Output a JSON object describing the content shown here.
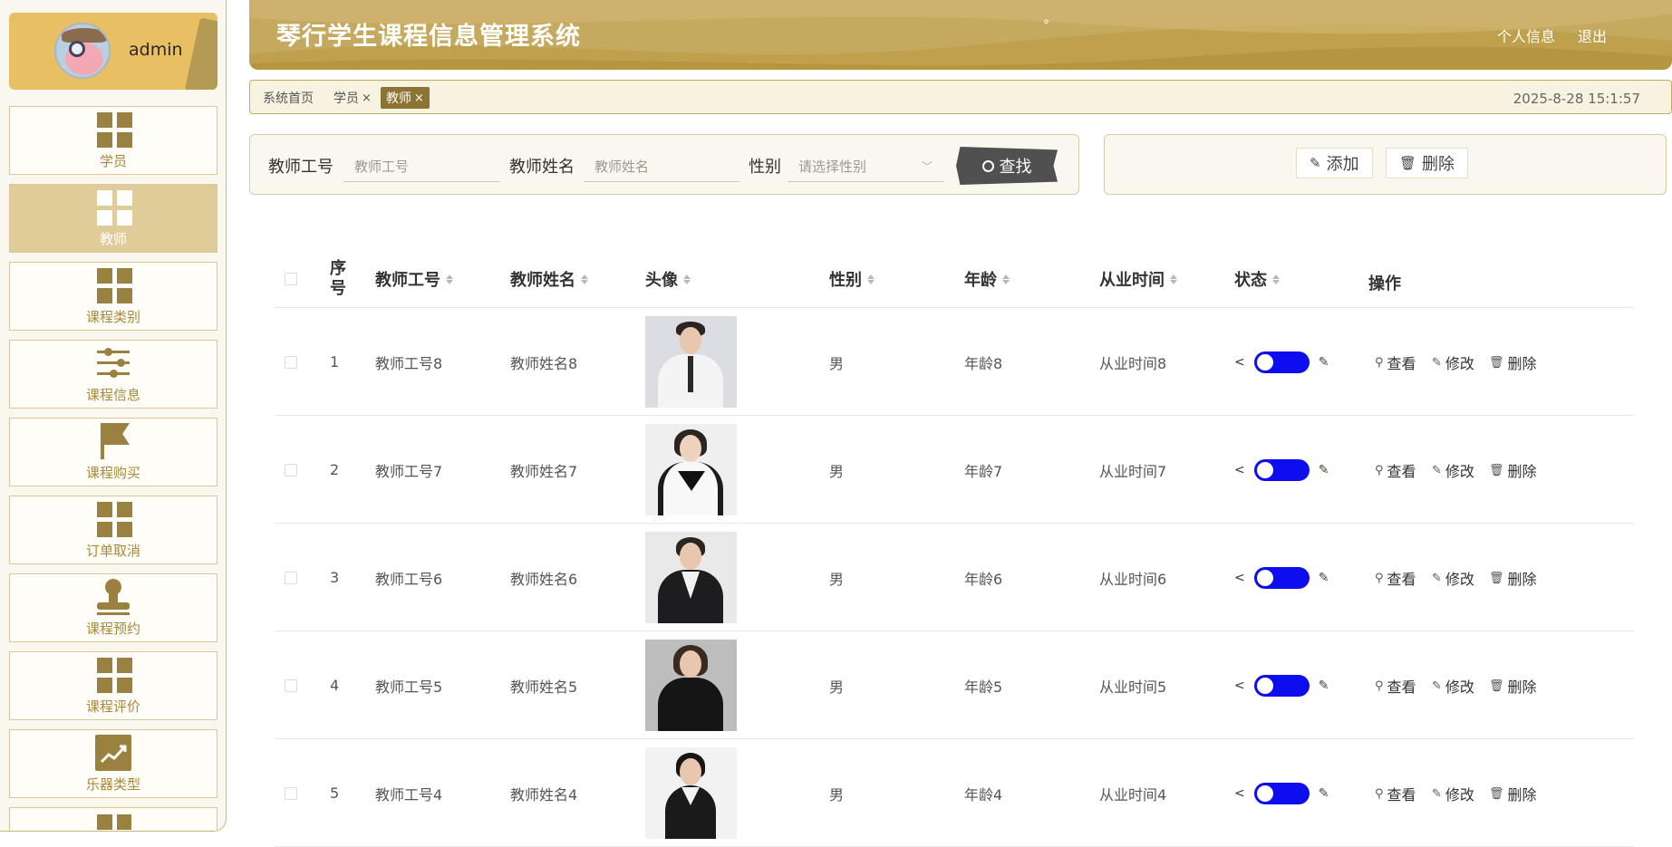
{
  "sidebar": {
    "username": "admin",
    "menu": [
      {
        "label": "学员",
        "icon": "grid-icon"
      },
      {
        "label": "教师",
        "icon": "grid-icon"
      },
      {
        "label": "课程类别",
        "icon": "grid-icon"
      },
      {
        "label": "课程信息",
        "icon": "sliders-icon"
      },
      {
        "label": "课程购买",
        "icon": "flag-icon"
      },
      {
        "label": "订单取消",
        "icon": "grid-icon"
      },
      {
        "label": "课程预约",
        "icon": "stamp-icon"
      },
      {
        "label": "课程评价",
        "icon": "grid-icon"
      },
      {
        "label": "乐器类型",
        "icon": "chart-icon"
      }
    ],
    "active_index": 1
  },
  "header": {
    "title": "琴行学生课程信息管理系统",
    "profile_link": "个人信息",
    "logout_link": "退出",
    "dot": "°"
  },
  "tabs": {
    "items": [
      {
        "label": "系统首页",
        "closable": false
      },
      {
        "label": "学员",
        "closable": true
      },
      {
        "label": "教师",
        "closable": true
      }
    ],
    "close_glyph": "×",
    "datetime": "2025-8-28 15:1:57"
  },
  "search": {
    "fields": [
      {
        "label": "教师工号",
        "placeholder": "教师工号"
      },
      {
        "label": "教师姓名",
        "placeholder": "教师姓名"
      },
      {
        "label": "性别",
        "placeholder": "请选择性别"
      }
    ],
    "button_label": "查找"
  },
  "actions": {
    "add_label": "添加",
    "delete_label": "删除"
  },
  "table": {
    "headers": {
      "index": "序号",
      "teacher_id": "教师工号",
      "teacher_name": "教师姓名",
      "avatar": "头像",
      "gender": "性别",
      "age": "年龄",
      "experience": "从业时间",
      "status": "状态",
      "operations": "操作"
    },
    "op_labels": {
      "view": "查看",
      "edit": "修改",
      "delete": "删除"
    },
    "rows": [
      {
        "index": "1",
        "teacher_id": "教师工号8",
        "teacher_name": "教师姓名8",
        "gender": "男",
        "age": "年龄8",
        "experience": "从业时间8",
        "status_on": true
      },
      {
        "index": "2",
        "teacher_id": "教师工号7",
        "teacher_name": "教师姓名7",
        "gender": "男",
        "age": "年龄7",
        "experience": "从业时间7",
        "status_on": true
      },
      {
        "index": "3",
        "teacher_id": "教师工号6",
        "teacher_name": "教师姓名6",
        "gender": "男",
        "age": "年龄6",
        "experience": "从业时间6",
        "status_on": true
      },
      {
        "index": "4",
        "teacher_id": "教师工号5",
        "teacher_name": "教师姓名5",
        "gender": "男",
        "age": "年龄5",
        "experience": "从业时间5",
        "status_on": true
      },
      {
        "index": "5",
        "teacher_id": "教师工号4",
        "teacher_name": "教师姓名4",
        "gender": "男",
        "age": "年龄4",
        "experience": "从业时间4",
        "status_on": true
      }
    ]
  },
  "colors": {
    "header_gold": "#c5a95f",
    "active_tab": "#8d7334",
    "toggle_blue": "#0d0df0",
    "menu_active": "#dfcc99",
    "menu_text": "#a8893a"
  }
}
